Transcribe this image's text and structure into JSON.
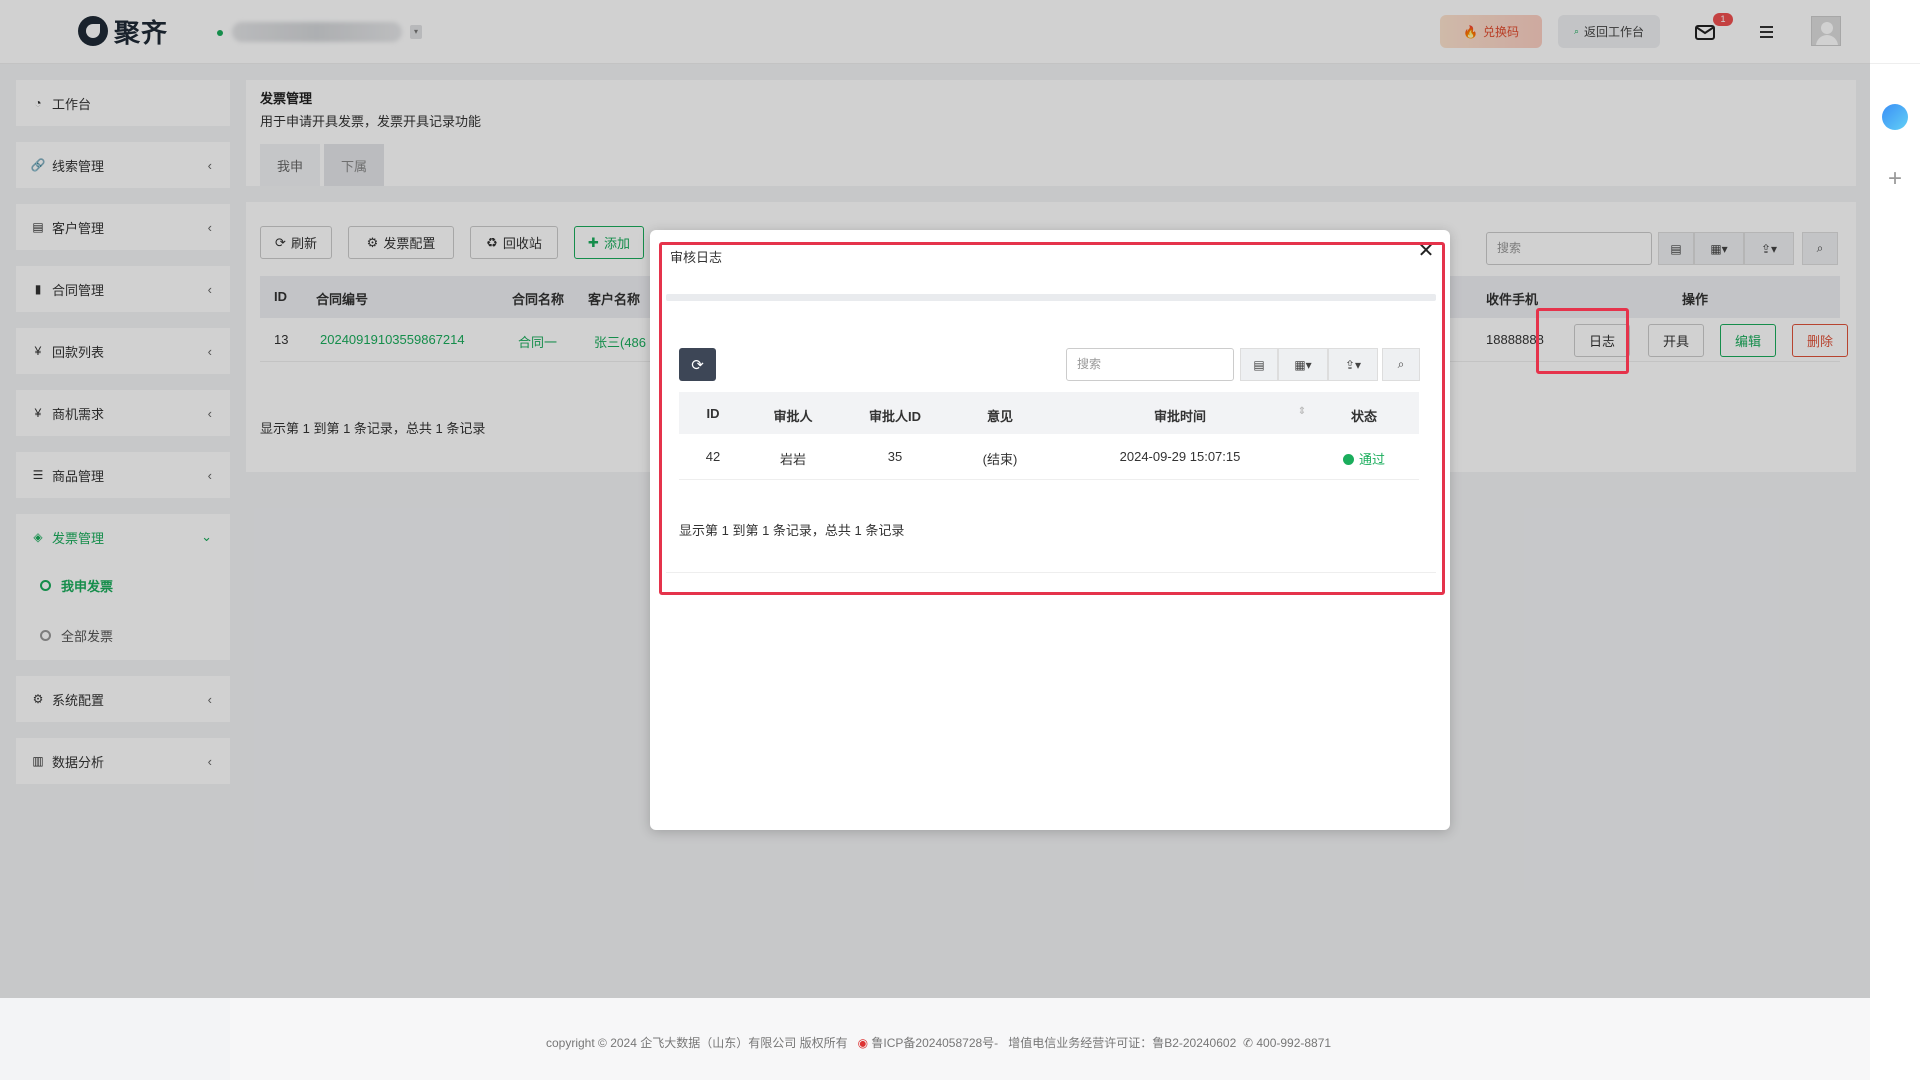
{
  "topbar": {
    "logo_text": "聚齐",
    "redeem_label": "兑换码",
    "back_label": "返回工作台",
    "mail_badge": "1"
  },
  "sidebar": {
    "items": [
      {
        "label": "工作台",
        "icon": "dashboard-icon"
      },
      {
        "label": "线索管理",
        "icon": "link-icon"
      },
      {
        "label": "客户管理",
        "icon": "id-card-icon"
      },
      {
        "label": "合同管理",
        "icon": "bookmark-icon"
      },
      {
        "label": "回款列表",
        "icon": "yen-icon"
      },
      {
        "label": "商机需求",
        "icon": "yen-icon"
      },
      {
        "label": "商品管理",
        "icon": "list-icon"
      },
      {
        "label": "发票管理",
        "icon": "tag-icon"
      },
      {
        "label": "系统配置",
        "icon": "gears-icon"
      },
      {
        "label": "数据分析",
        "icon": "bar-chart-icon"
      }
    ],
    "sub_items": [
      {
        "label": "我申发票"
      },
      {
        "label": "全部发票"
      }
    ]
  },
  "main": {
    "title": "发票管理",
    "description": "用于申请开具发票，发票开具记录功能",
    "tabs": [
      "我申",
      "下属"
    ],
    "toolbar": {
      "refresh": "刷新",
      "config": "发票配置",
      "recycle": "回收站",
      "add": "添加",
      "search_placeholder": "搜索"
    },
    "columns": [
      "ID",
      "合同编号",
      "合同名称",
      "客户名称",
      "收件手机",
      "操作"
    ],
    "rows": [
      {
        "id": "13",
        "contract_no": "20240919103559867214",
        "contract_name": "合同一",
        "customer": "张三(486",
        "phone": "18888888",
        "ops": [
          "日志",
          "开具",
          "编辑",
          "删除"
        ]
      }
    ],
    "pager": "显示第 1 到第 1 条记录，总共 1 条记录"
  },
  "modal": {
    "title": "审核日志",
    "search_placeholder": "搜索",
    "columns": [
      "ID",
      "审批人",
      "审批人ID",
      "意见",
      "审批时间",
      "状态"
    ],
    "rows": [
      {
        "id": "42",
        "approver": "岩岩",
        "approver_id": "35",
        "opinion": "(结束)",
        "time": "2024-09-29 15:07:15",
        "status": "通过"
      }
    ],
    "pager": "显示第 1 到第 1 条记录，总共 1 条记录"
  },
  "footer": {
    "text": "copyright © 2024 企飞大数据（山东）有限公司 版权所有",
    "icp": "鲁ICP备2024058728号-",
    "license": "增值电信业务经营许可证：鲁B2-20240602",
    "phone": "400-992-8871"
  },
  "colors": {
    "accent": "#1aad5c",
    "danger": "#e0533b",
    "highlight": "#e5334b"
  }
}
